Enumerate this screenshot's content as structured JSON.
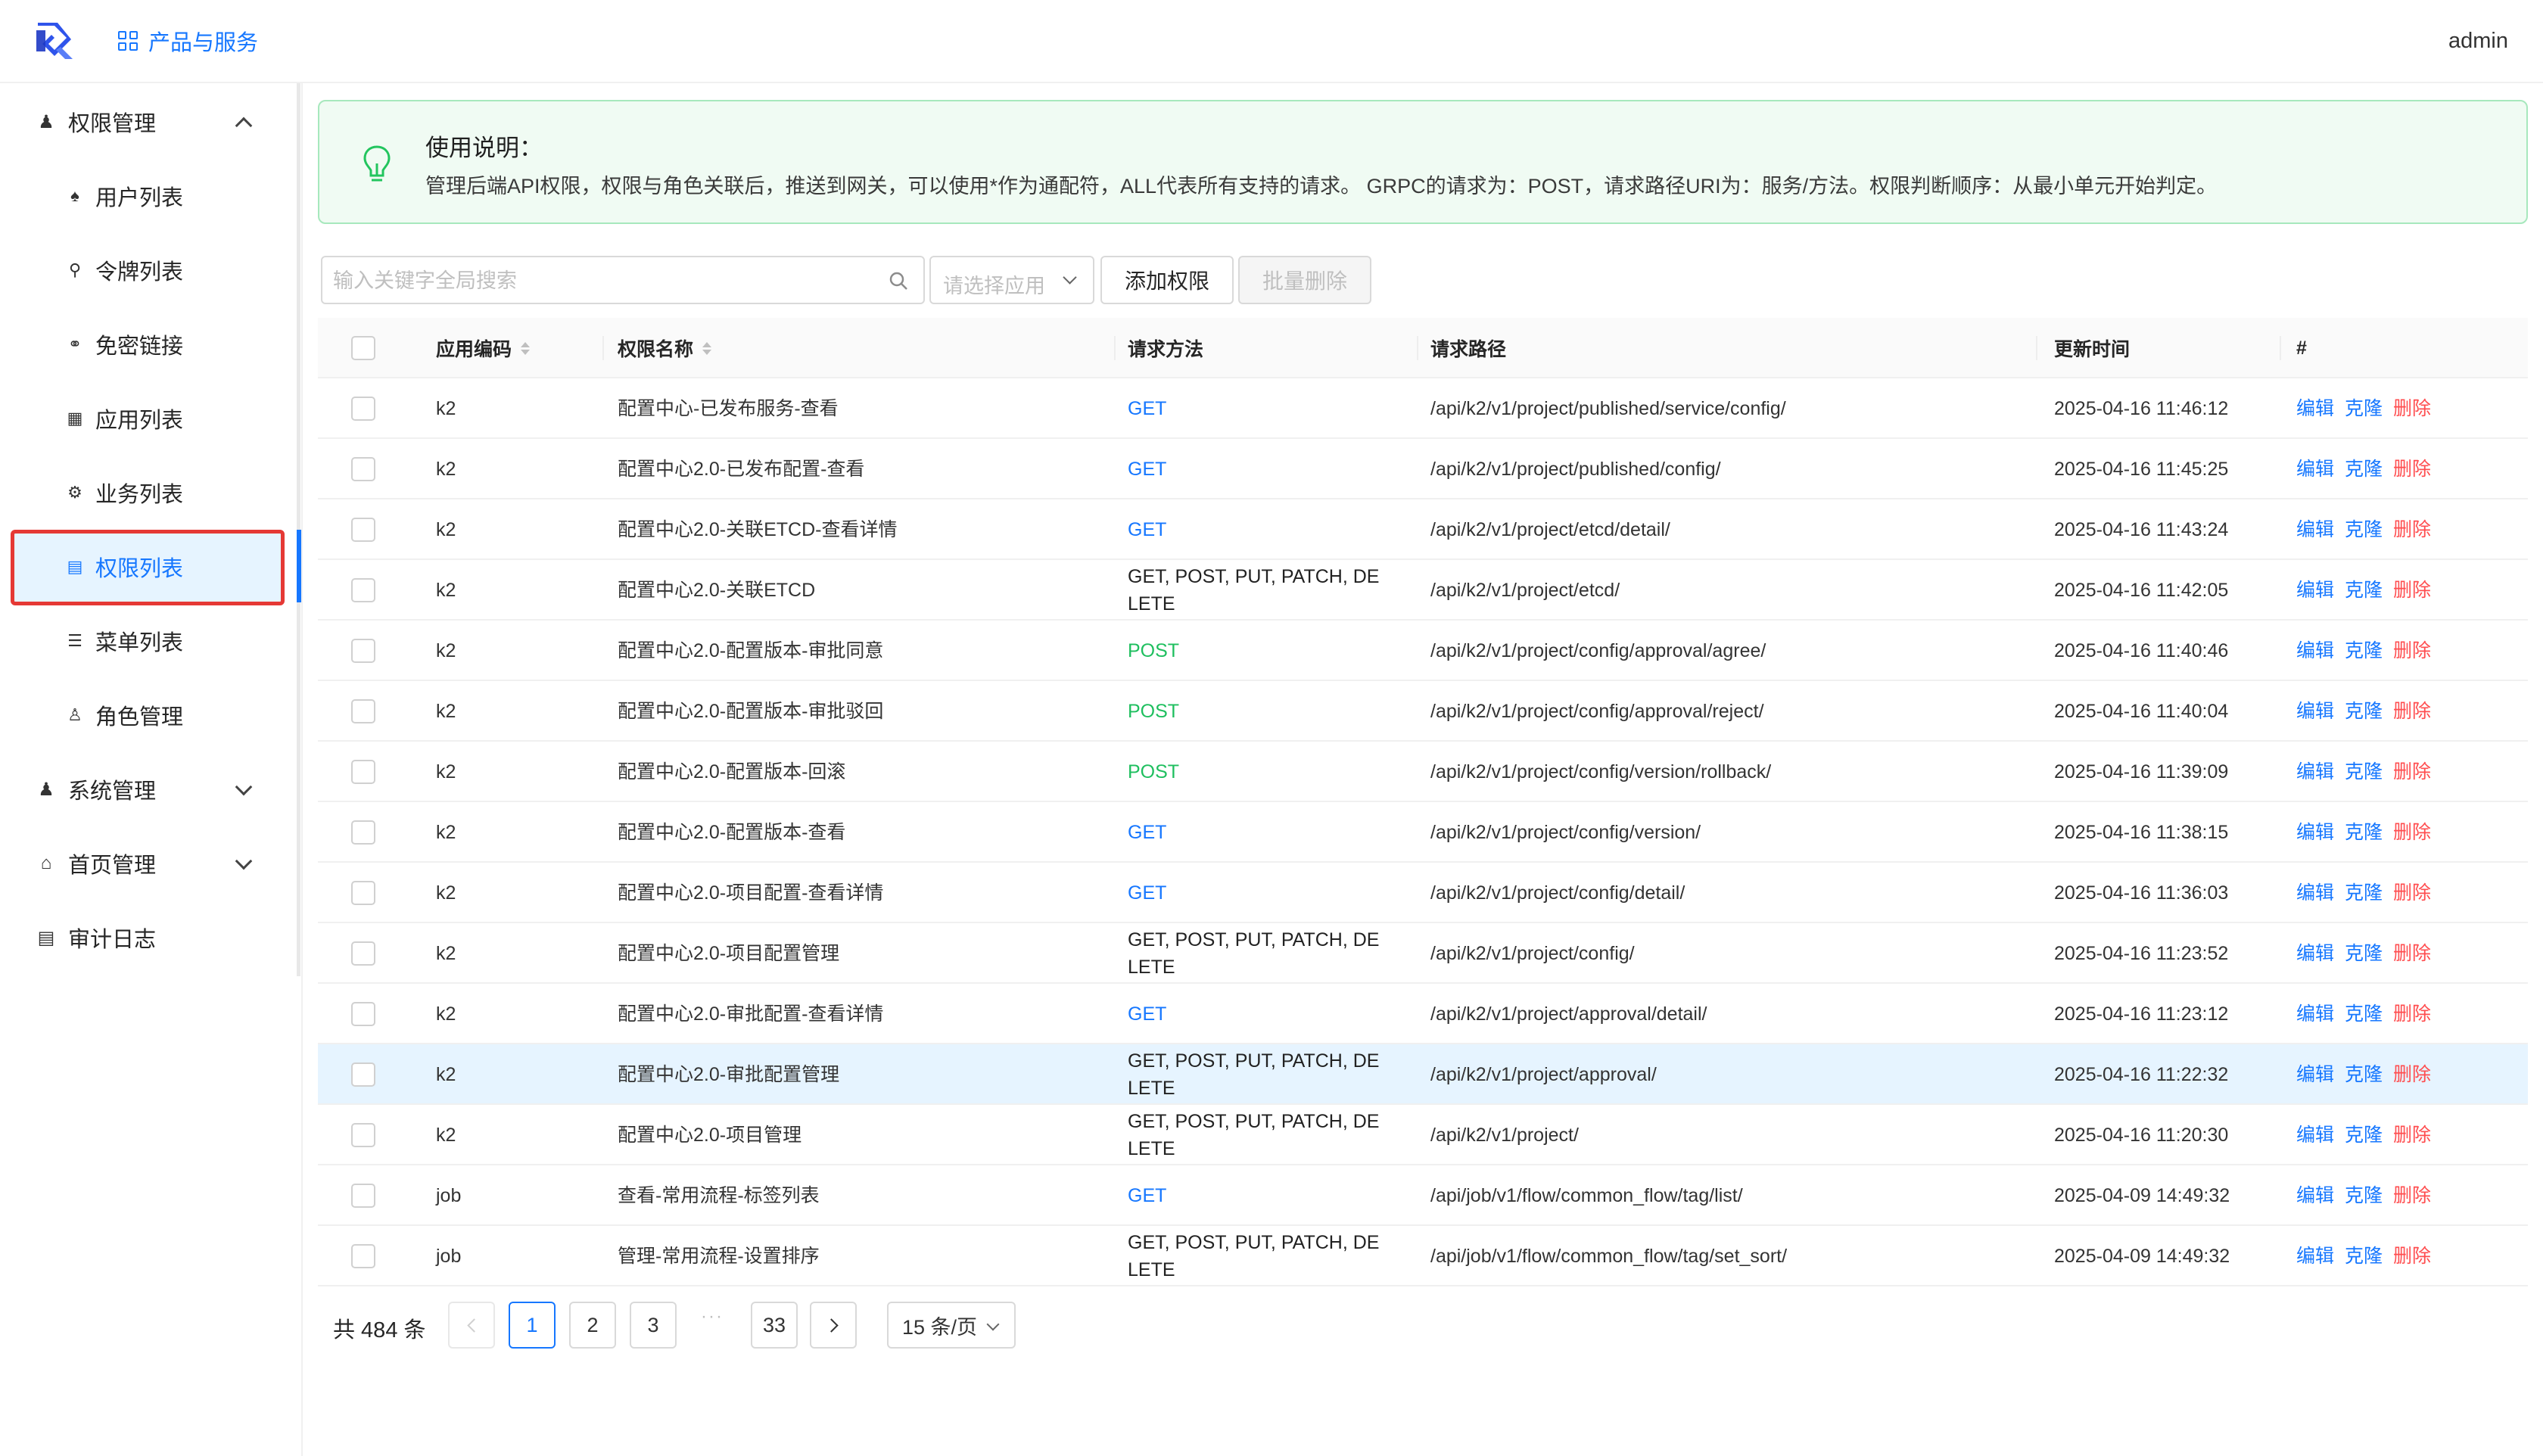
{
  "header": {
    "products_label": "产品与服务",
    "user": "admin"
  },
  "sidebar": {
    "groups": [
      {
        "label": "权限管理",
        "icon": "users-icon",
        "expanded": true
      },
      {
        "label": "系统管理",
        "icon": "users-icon",
        "expanded": false
      },
      {
        "label": "首页管理",
        "icon": "home-icon",
        "expanded": false
      },
      {
        "label": "审计日志",
        "icon": "document-icon",
        "expanded": false
      }
    ],
    "items": [
      {
        "label": "用户列表",
        "icon": "team-icon"
      },
      {
        "label": "令牌列表",
        "icon": "key-icon"
      },
      {
        "label": "免密链接",
        "icon": "link-icon"
      },
      {
        "label": "应用列表",
        "icon": "apps-icon"
      },
      {
        "label": "业务列表",
        "icon": "robot-icon"
      },
      {
        "label": "权限列表",
        "icon": "lock-icon",
        "active": true
      },
      {
        "label": "菜单列表",
        "icon": "menu-icon"
      },
      {
        "label": "角色管理",
        "icon": "user-icon"
      }
    ]
  },
  "alert": {
    "title": "使用说明：",
    "description": "管理后端API权限，权限与角色关联后，推送到网关，可以使用*作为通配符，ALL代表所有支持的请求。 GRPC的请求为：POST，请求路径URI为：服务/方法。权限判断顺序：从最小单元开始判定。"
  },
  "toolbar": {
    "search_placeholder": "输入关键字全局搜索",
    "app_select_placeholder": "请选择应用",
    "add_label": "添加权限",
    "bulk_delete_label": "批量删除"
  },
  "table": {
    "columns": {
      "app_code": "应用编码",
      "name": "权限名称",
      "method": "请求方法",
      "path": "请求路径",
      "updated": "更新时间",
      "ops": "#"
    },
    "actions": {
      "edit": "编辑",
      "clone": "克隆",
      "delete": "删除"
    },
    "rows": [
      {
        "app": "k2",
        "name": "配置中心-已发布服务-查看",
        "method": "GET",
        "method_type": "get",
        "path": "/api/k2/v1/project/published/service/config/",
        "updated": "2025-04-16 11:46:12"
      },
      {
        "app": "k2",
        "name": "配置中心2.0-已发布配置-查看",
        "method": "GET",
        "method_type": "get",
        "path": "/api/k2/v1/project/published/config/",
        "updated": "2025-04-16 11:45:25"
      },
      {
        "app": "k2",
        "name": "配置中心2.0-关联ETCD-查看详情",
        "method": "GET",
        "method_type": "get",
        "path": "/api/k2/v1/project/etcd/detail/",
        "updated": "2025-04-16 11:43:24"
      },
      {
        "app": "k2",
        "name": "配置中心2.0-关联ETCD",
        "method": "GET, POST, PUT, PATCH, DELETE",
        "method_type": "multi",
        "path": "/api/k2/v1/project/etcd/",
        "updated": "2025-04-16 11:42:05"
      },
      {
        "app": "k2",
        "name": "配置中心2.0-配置版本-审批同意",
        "method": "POST",
        "method_type": "post",
        "path": "/api/k2/v1/project/config/approval/agree/",
        "updated": "2025-04-16 11:40:46"
      },
      {
        "app": "k2",
        "name": "配置中心2.0-配置版本-审批驳回",
        "method": "POST",
        "method_type": "post",
        "path": "/api/k2/v1/project/config/approval/reject/",
        "updated": "2025-04-16 11:40:04"
      },
      {
        "app": "k2",
        "name": "配置中心2.0-配置版本-回滚",
        "method": "POST",
        "method_type": "post",
        "path": "/api/k2/v1/project/config/version/rollback/",
        "updated": "2025-04-16 11:39:09"
      },
      {
        "app": "k2",
        "name": "配置中心2.0-配置版本-查看",
        "method": "GET",
        "method_type": "get",
        "path": "/api/k2/v1/project/config/version/",
        "updated": "2025-04-16 11:38:15"
      },
      {
        "app": "k2",
        "name": "配置中心2.0-项目配置-查看详情",
        "method": "GET",
        "method_type": "get",
        "path": "/api/k2/v1/project/config/detail/",
        "updated": "2025-04-16 11:36:03"
      },
      {
        "app": "k2",
        "name": "配置中心2.0-项目配置管理",
        "method": "GET, POST, PUT, PATCH, DELETE",
        "method_type": "multi",
        "path": "/api/k2/v1/project/config/",
        "updated": "2025-04-16 11:23:52"
      },
      {
        "app": "k2",
        "name": "配置中心2.0-审批配置-查看详情",
        "method": "GET",
        "method_type": "get",
        "path": "/api/k2/v1/project/approval/detail/",
        "updated": "2025-04-16 11:23:12"
      },
      {
        "app": "k2",
        "name": "配置中心2.0-审批配置管理",
        "method": "GET, POST, PUT, PATCH, DELETE",
        "method_type": "multi",
        "path": "/api/k2/v1/project/approval/",
        "updated": "2025-04-16 11:22:32",
        "highlighted": true
      },
      {
        "app": "k2",
        "name": "配置中心2.0-项目管理",
        "method": "GET, POST, PUT, PATCH, DELETE",
        "method_type": "multi",
        "path": "/api/k2/v1/project/",
        "updated": "2025-04-16 11:20:30"
      },
      {
        "app": "job",
        "name": "查看-常用流程-标签列表",
        "method": "GET",
        "method_type": "get",
        "path": "/api/job/v1/flow/common_flow/tag/list/",
        "updated": "2025-04-09 14:49:32"
      },
      {
        "app": "job",
        "name": "管理-常用流程-设置排序",
        "method": "GET, POST, PUT, PATCH, DELETE",
        "method_type": "multi",
        "path": "/api/job/v1/flow/common_flow/tag/set_sort/",
        "updated": "2025-04-09 14:49:32"
      }
    ]
  },
  "pagination": {
    "total_label": "共 484 条",
    "pages": [
      "1",
      "2",
      "3"
    ],
    "ellipsis": "···",
    "last_page": "33",
    "current_page": "1",
    "page_size_label": "15 条/页"
  }
}
